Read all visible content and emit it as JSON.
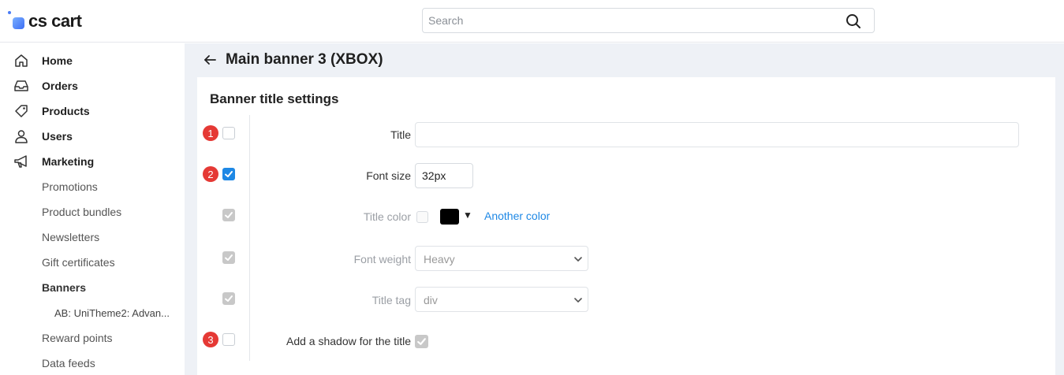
{
  "app": {
    "logo_text": "cs cart"
  },
  "search": {
    "placeholder": "Search"
  },
  "sidebar": {
    "items": [
      {
        "label": "Home",
        "icon": "home-icon"
      },
      {
        "label": "Orders",
        "icon": "inbox-icon"
      },
      {
        "label": "Products",
        "icon": "tag-icon"
      },
      {
        "label": "Users",
        "icon": "user-icon"
      },
      {
        "label": "Marketing",
        "icon": "megaphone-icon"
      }
    ],
    "marketing_sub": [
      {
        "label": "Promotions"
      },
      {
        "label": "Product bundles"
      },
      {
        "label": "Newsletters"
      },
      {
        "label": "Gift certificates"
      },
      {
        "label": "Banners",
        "active": true
      },
      {
        "label": "Reward points"
      },
      {
        "label": "Data feeds"
      }
    ],
    "banners_sub": [
      {
        "label": "AB: UniTheme2: Advan..."
      }
    ]
  },
  "page": {
    "title": "Main banner 3 (XBOX)",
    "section_title": "Banner title settings"
  },
  "form": {
    "rows": [
      {
        "badge": "1",
        "label": "Title",
        "value": "",
        "checkbox": "unchecked"
      },
      {
        "badge": "2",
        "label": "Font size",
        "value": "32px",
        "checkbox": "checked"
      },
      {
        "badge": "",
        "label": "Title color",
        "checkbox": "disabled-checked",
        "color": "#000000",
        "another_color_label": "Another color"
      },
      {
        "badge": "",
        "label": "Font weight",
        "value": "Heavy",
        "checkbox": "disabled-checked"
      },
      {
        "badge": "",
        "label": "Title tag",
        "value": "div",
        "checkbox": "disabled-checked"
      },
      {
        "badge": "3",
        "label": "Add a shadow for the title",
        "checkbox": "unchecked",
        "shadow_checked": true
      }
    ]
  },
  "colors": {
    "accent": "#1e88e5",
    "badge": "#e53935",
    "main_bg": "#eef1f6"
  }
}
